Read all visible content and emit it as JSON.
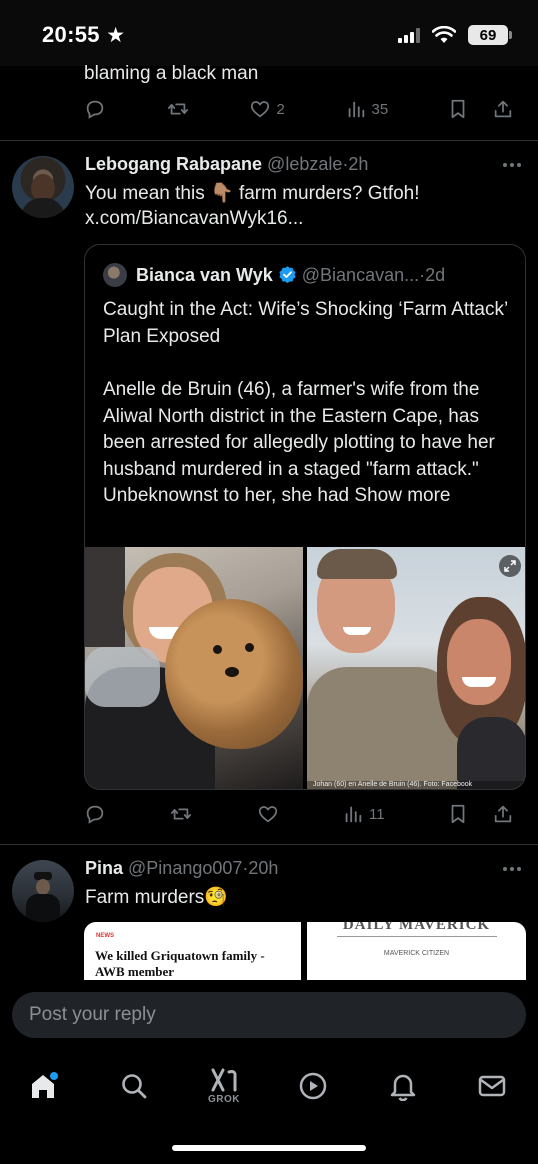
{
  "status": {
    "time": "20:55",
    "battery": "69"
  },
  "prev_post": {
    "text_tail": "blaming a black man",
    "likes": "2",
    "views": "35"
  },
  "reply": {
    "name": "Lebogang Rabapane",
    "handle": "@lebzale",
    "time": "2h",
    "text_a": "You mean this",
    "emoji": "👇🏽",
    "text_b": "farm murders? Gtfoh!",
    "link": "x.com/BiancavanWyk16...",
    "views": "11"
  },
  "quote": {
    "name": "Bianca van Wyk",
    "handle": "@Biancavan...",
    "time": "2d",
    "headline": "Caught in the Act: Wife’s Shocking ‘Farm Attack’ Plan Exposed",
    "body": "Anelle de Bruin (46), a farmer's wife from the Aliwal North district in the Eastern Cape, has been arrested for allegedly plotting to have her husband murdered in a staged \"farm attack.\" Unbeknownst to her, she had",
    "show_more": "Show more",
    "photo_caption": "Johan (60) en Anelle de Bruin (46). Foto: Facebook"
  },
  "pina": {
    "name": "Pina",
    "handle": "@Pinango007",
    "time": "20h",
    "text": "Farm murders",
    "emoji": "🧐",
    "preview1_badge": "NEWS",
    "preview1_title": "We killed Griquatown family - AWB member",
    "preview2_masthead": "DAILY MAVERICK",
    "preview2_section": "MAVERICK CITIZEN"
  },
  "composer": {
    "placeholder": "Post your reply"
  },
  "tabs": {
    "grok_label": "GROK"
  },
  "colors": {
    "accent": "#1d9bf0",
    "muted": "#71767b",
    "background": "#000000",
    "notification_dot": "#1d9bf0"
  },
  "icons": [
    "star-icon",
    "signal-icon",
    "wifi-icon",
    "reply-icon",
    "repost-icon",
    "like-icon",
    "views-icon",
    "bookmark-icon",
    "share-icon",
    "more-icon",
    "verified-icon",
    "expand-icon",
    "home-icon",
    "search-icon",
    "grok-icon",
    "video-icon",
    "notifications-icon",
    "messages-icon"
  ]
}
